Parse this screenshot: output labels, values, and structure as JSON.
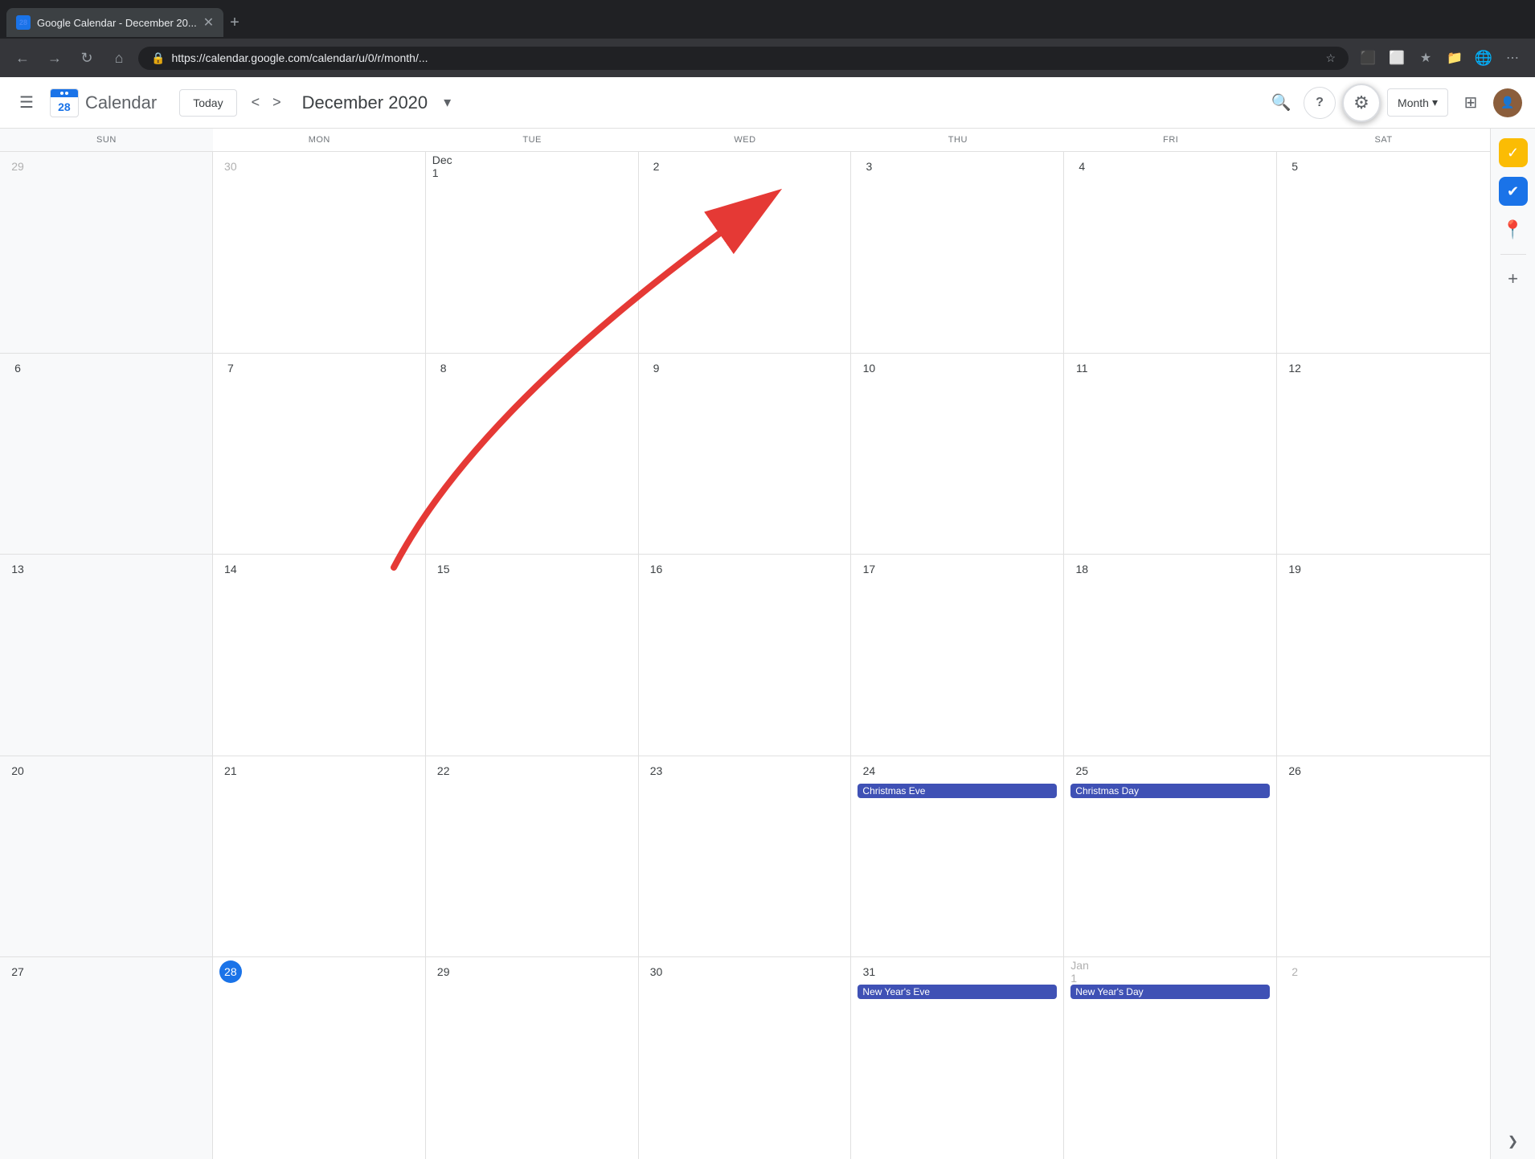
{
  "browser": {
    "tab_title": "Google Calendar - December 20...",
    "tab_favicon": "28",
    "address": "https://calendar.google.com/calendar/u/0/r/month/...",
    "new_tab_label": "+"
  },
  "header": {
    "menu_icon": "☰",
    "logo_number": "28",
    "app_name": "Calendar",
    "today_label": "Today",
    "month_title": "December 2020",
    "settings_icon": "⚙",
    "help_icon": "?",
    "search_icon": "🔍",
    "month_view_label": "Month",
    "dropdown_arrow": "▾",
    "apps_icon": "⋮⋮⋮"
  },
  "calendar": {
    "day_headers": [
      "SUN",
      "MON",
      "TUE",
      "WED",
      "THU",
      "FRI",
      "SAT"
    ],
    "weeks": [
      {
        "days": [
          {
            "number": "29",
            "type": "other-month"
          },
          {
            "number": "30",
            "type": "other-month"
          },
          {
            "number": "Dec 1",
            "type": "normal"
          },
          {
            "number": "2",
            "type": "normal"
          },
          {
            "number": "3",
            "type": "normal"
          },
          {
            "number": "4",
            "type": "normal"
          },
          {
            "number": "5",
            "type": "normal"
          }
        ]
      },
      {
        "days": [
          {
            "number": "6",
            "type": "normal"
          },
          {
            "number": "7",
            "type": "normal"
          },
          {
            "number": "8",
            "type": "normal"
          },
          {
            "number": "9",
            "type": "normal"
          },
          {
            "number": "10",
            "type": "normal"
          },
          {
            "number": "11",
            "type": "normal"
          },
          {
            "number": "12",
            "type": "normal"
          }
        ]
      },
      {
        "days": [
          {
            "number": "13",
            "type": "normal"
          },
          {
            "number": "14",
            "type": "normal"
          },
          {
            "number": "15",
            "type": "normal"
          },
          {
            "number": "16",
            "type": "normal"
          },
          {
            "number": "17",
            "type": "normal"
          },
          {
            "number": "18",
            "type": "normal"
          },
          {
            "number": "19",
            "type": "normal"
          }
        ]
      },
      {
        "days": [
          {
            "number": "20",
            "type": "normal"
          },
          {
            "number": "21",
            "type": "normal"
          },
          {
            "number": "22",
            "type": "normal"
          },
          {
            "number": "23",
            "type": "normal"
          },
          {
            "number": "24",
            "type": "normal",
            "event": "Christmas Eve"
          },
          {
            "number": "25",
            "type": "normal",
            "event": "Christmas Day"
          },
          {
            "number": "26",
            "type": "normal"
          }
        ]
      },
      {
        "days": [
          {
            "number": "27",
            "type": "normal"
          },
          {
            "number": "28",
            "type": "today"
          },
          {
            "number": "29",
            "type": "normal"
          },
          {
            "number": "30",
            "type": "normal"
          },
          {
            "number": "31",
            "type": "normal",
            "event": "New Year's Eve"
          },
          {
            "number": "Jan 1",
            "type": "other-month",
            "event": "New Year's Day"
          },
          {
            "number": "2",
            "type": "other-month"
          }
        ]
      }
    ]
  },
  "sidebar": {
    "icon1_color": "#FBBC04",
    "icon2_color": "#1a73e8",
    "icon3_color": "#34A853",
    "add_label": "+"
  }
}
